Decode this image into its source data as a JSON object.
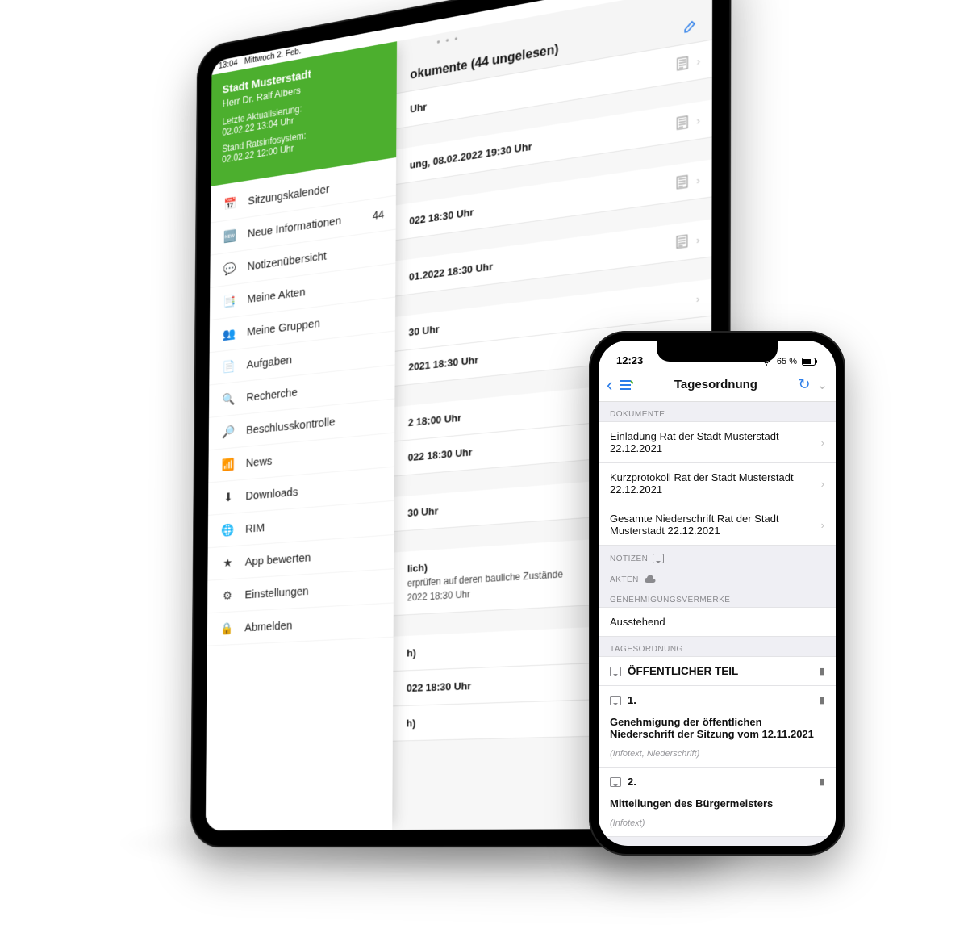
{
  "ipad": {
    "status": {
      "time": "13:04",
      "date": "Mittwoch 2. Feb."
    },
    "sidebar": {
      "city": "Stadt Musterstadt",
      "user": "Herr Dr. Ralf Albers",
      "last_update_label": "Letzte Aktualisierung:",
      "last_update_value": "02.02.22 13:04 Uhr",
      "sys_state_label": "Stand Ratsinfosystem:",
      "sys_state_value": "02.02.22 12:00 Uhr",
      "items": [
        {
          "icon": "calendar-icon",
          "glyph": "📅",
          "label": "Sitzungskalender"
        },
        {
          "icon": "new-info-icon",
          "glyph": "🆕",
          "label": "Neue Informationen",
          "badge": "44"
        },
        {
          "icon": "notes-icon",
          "glyph": "💬",
          "label": "Notizenübersicht"
        },
        {
          "icon": "files-icon",
          "glyph": "📑",
          "label": "Meine Akten"
        },
        {
          "icon": "groups-icon",
          "glyph": "👥",
          "label": "Meine Gruppen"
        },
        {
          "icon": "tasks-icon",
          "glyph": "📄",
          "label": "Aufgaben"
        },
        {
          "icon": "search-icon",
          "glyph": "🔍",
          "label": "Recherche"
        },
        {
          "icon": "decision-icon",
          "glyph": "🔎",
          "label": "Beschlusskontrolle"
        },
        {
          "icon": "news-icon",
          "glyph": "📶",
          "label": "News"
        },
        {
          "icon": "download-icon",
          "glyph": "⬇",
          "label": "Downloads"
        },
        {
          "icon": "rim-icon",
          "glyph": "🌐",
          "label": "RIM"
        },
        {
          "icon": "rate-icon",
          "glyph": "★",
          "label": "App bewerten"
        },
        {
          "icon": "settings-icon",
          "glyph": "⚙",
          "label": "Einstellungen"
        },
        {
          "icon": "logout-icon",
          "glyph": "🔒",
          "label": "Abmelden"
        }
      ]
    },
    "main": {
      "title": "okumente (44 ungelesen)",
      "rows": [
        {
          "text": "Uhr",
          "has_doc": true,
          "gap_before": false
        },
        {
          "text": "ung, 08.02.2022 19:30 Uhr",
          "has_doc": true,
          "gap_before": true
        },
        {
          "text": "022 18:30 Uhr",
          "has_doc": true,
          "gap_before": true
        },
        {
          "text": "01.2022 18:30 Uhr",
          "has_doc": true,
          "gap_before": true
        },
        {
          "text": "30 Uhr",
          "has_doc": false,
          "gap_before": true
        },
        {
          "text": "2021 18:30 Uhr",
          "has_doc": false,
          "gap_before": false
        },
        {
          "text": "2 18:00 Uhr",
          "has_doc": false,
          "gap_before": true
        },
        {
          "text": "022 18:30 Uhr",
          "has_doc": false,
          "gap_before": false
        },
        {
          "text": "30 Uhr",
          "has_doc": false,
          "gap_before": true
        },
        {
          "text": "lich)",
          "sub": "erprüfen auf deren bauliche Zustände",
          "line3": "2022 18:30 Uhr",
          "has_doc": false,
          "gap_before": true
        },
        {
          "text": "h)",
          "has_doc": false,
          "gap_before": true
        },
        {
          "text": "022 18:30 Uhr",
          "has_doc": false,
          "gap_before": false
        },
        {
          "text": "h)",
          "has_doc": false,
          "gap_before": false
        }
      ]
    }
  },
  "iphone": {
    "status": {
      "time": "12:23",
      "battery": "65 %",
      "signal_icon": "wifi-icon"
    },
    "nav": {
      "title": "Tagesordnung"
    },
    "sections": {
      "dokumente_label": "DOKUMENTE",
      "docs": [
        "Einladung Rat der Stadt Musterstadt 22.12.2021",
        "Kurzprotokoll Rat der Stadt Musterstadt 22.12.2021",
        "Gesamte Niederschrift Rat der Stadt Musterstadt 22.12.2021"
      ],
      "notizen_label": "NOTIZEN",
      "akten_label": "AKTEN",
      "genehmigung_label": "GENEHMIGUNGSVERMERKE",
      "genehmigung_value": "Ausstehend",
      "tagesordnung_label": "TAGESORDNUNG",
      "agenda_header": "ÖFFENTLICHER TEIL",
      "agenda": [
        {
          "num": "1.",
          "title": "Genehmigung der öffentlichen Niederschrift der Sitzung vom 12.11.2021",
          "meta": "(Infotext, Niederschrift)"
        },
        {
          "num": "2.",
          "title": "Mitteilungen des Bürgermeisters",
          "meta": "(Infotext)"
        }
      ]
    }
  }
}
